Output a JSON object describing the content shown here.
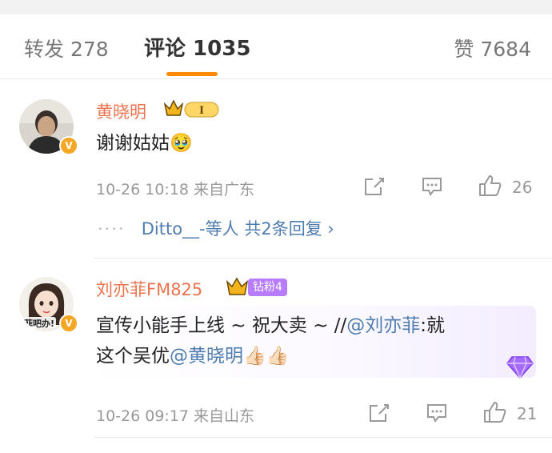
{
  "tabs": {
    "repost": "转发 278",
    "comments": "评论 1035",
    "likes": "赞 7684"
  },
  "comments": [
    {
      "username": "黄晓明",
      "level_badge": "I",
      "text": "谢谢姑姑",
      "emoji": "🥹",
      "time_location": "10-26 10:18  来自广东",
      "like_count": "26",
      "replies": {
        "users": "Ditto__-等人",
        "count_label": "共2条回复"
      }
    },
    {
      "username": "刘亦菲FM825",
      "fan_badge": "钻粉4",
      "text_part1": "宣传小能手上线 ~ 祝大卖 ~ //",
      "mention1": "@刘亦菲",
      "text_part2": ":就",
      "text_line2": "这个吴优",
      "mention2": "@黄晓明",
      "emoji": "👍🏻👍🏻",
      "avatar_text": "菲吧办!",
      "time_location": "10-26 09:17  来自山东",
      "like_count": "21"
    }
  ],
  "icons": {
    "verified": "V",
    "chevron": "›"
  },
  "colors": {
    "accent": "#ff8a00",
    "username": "#eb7350",
    "mention": "#507daf"
  }
}
